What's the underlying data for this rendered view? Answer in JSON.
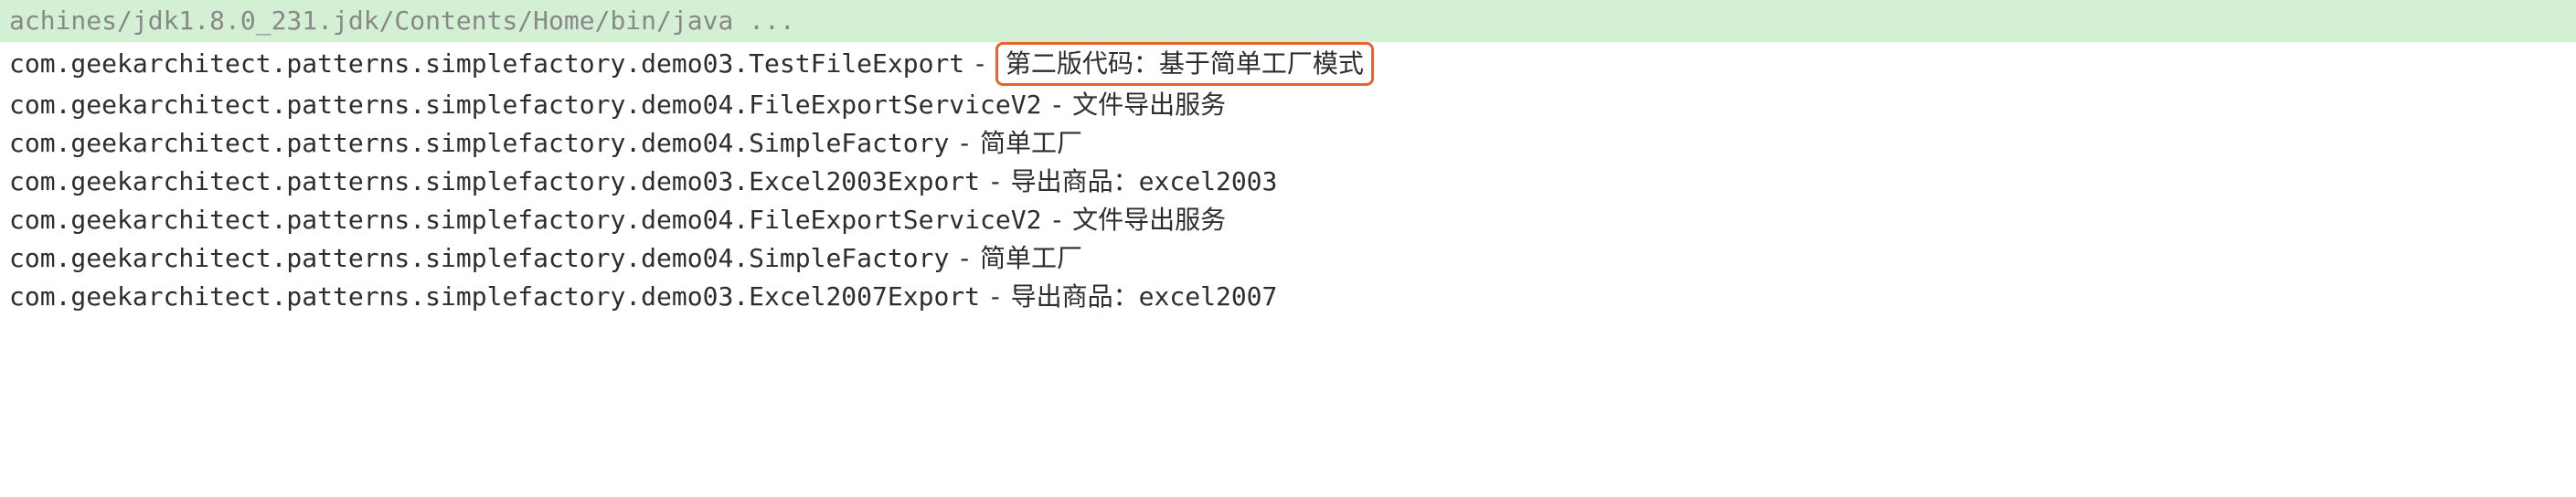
{
  "header": {
    "text": "achines/jdk1.8.0_231.jdk/Contents/Home/bin/java ..."
  },
  "lines": [
    {
      "class": "com.geekarchitect.patterns.simplefactory.demo03.TestFileExport",
      "separator": "-",
      "message": "第二版代码：基于简单工厂模式",
      "highlighted": true
    },
    {
      "class": "com.geekarchitect.patterns.simplefactory.demo04.FileExportServiceV2",
      "separator": "-",
      "message": "文件导出服务",
      "highlighted": false
    },
    {
      "class": "com.geekarchitect.patterns.simplefactory.demo04.SimpleFactory",
      "separator": "-",
      "message": "简单工厂",
      "highlighted": false
    },
    {
      "class": "com.geekarchitect.patterns.simplefactory.demo03.Excel2003Export",
      "separator": "-",
      "message": "导出商品：excel2003",
      "highlighted": false
    },
    {
      "class": "com.geekarchitect.patterns.simplefactory.demo04.FileExportServiceV2",
      "separator": "-",
      "message": "文件导出服务",
      "highlighted": false
    },
    {
      "class": "com.geekarchitect.patterns.simplefactory.demo04.SimpleFactory",
      "separator": "-",
      "message": "简单工厂",
      "highlighted": false
    },
    {
      "class": "com.geekarchitect.patterns.simplefactory.demo03.Excel2007Export",
      "separator": "-",
      "message": "导出商品：excel2007",
      "highlighted": false
    }
  ]
}
